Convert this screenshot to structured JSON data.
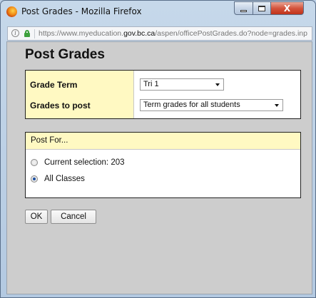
{
  "window": {
    "title": "Post Grades - Mozilla Firefox",
    "close_glyph": "X"
  },
  "urlbar": {
    "info_glyph": "i",
    "url_prefix": "https://www.myeducation.",
    "url_domain": "gov.bc.ca",
    "url_path": "/aspen/officePostGrades.do?node=grades.inp"
  },
  "page": {
    "title": "Post Grades",
    "grade_term_label": "Grade Term",
    "grade_term_value": "Tri 1",
    "grades_to_post_label": "Grades to post",
    "grades_to_post_value": "Term grades for all students",
    "post_for_header": "Post For...",
    "options": [
      {
        "label": "Current selection: 203",
        "checked": false
      },
      {
        "label": "All Classes",
        "checked": true
      }
    ],
    "ok_label": "OK",
    "cancel_label": "Cancel"
  },
  "colors": {
    "header_yellow": "#fff9c2",
    "close_red": "#c0321a",
    "secure_green": "#3da13d"
  },
  "icons": [
    "firefox-icon",
    "minimize-icon",
    "maximize-icon",
    "close-icon",
    "info-icon",
    "lock-icon",
    "dropdown-arrow-icon",
    "radio-icon"
  ]
}
